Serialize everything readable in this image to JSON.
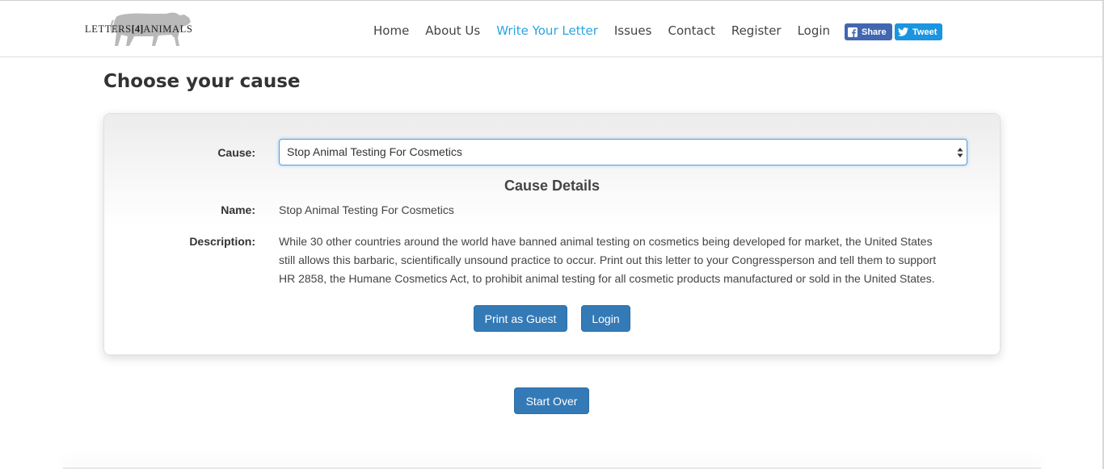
{
  "brand": {
    "logo_text_before": "LETTERS",
    "logo_text_mid": "[4]",
    "logo_text_after": "ANIMALS"
  },
  "nav": {
    "items": [
      {
        "label": "Home",
        "active": false
      },
      {
        "label": "About Us",
        "active": false
      },
      {
        "label": "Write Your Letter",
        "active": true
      },
      {
        "label": "Issues",
        "active": false
      },
      {
        "label": "Contact",
        "active": false
      },
      {
        "label": "Register",
        "active": false
      },
      {
        "label": "Login",
        "active": false
      }
    ],
    "active_color": "#2aa4df"
  },
  "social": {
    "facebook_label": "Share",
    "twitter_label": "Tweet",
    "facebook_color": "#4267b2",
    "twitter_color": "#1b95e0"
  },
  "page": {
    "title": "Choose your cause"
  },
  "form": {
    "cause_label": "Cause:",
    "cause_selected": "Stop Animal Testing For Cosmetics",
    "details_title": "Cause Details",
    "name_label": "Name:",
    "name_value": "Stop Animal Testing For Cosmetics",
    "description_label": "Description:",
    "description_value": "While 30 other countries around the world have banned animal testing on cosmetics being developed for market, the United States still allows this barbaric, scientifically unsound practice to occur. Print out this letter to your Congressperson and tell them to support HR 2858, the Humane Cosmetics Act, to prohibit animal testing for all cosmetic products manufactured or sold in the United States.",
    "print_guest_label": "Print as Guest",
    "login_label": "Login"
  },
  "footer": {
    "start_over_label": "Start Over"
  },
  "colors": {
    "primary_button": "#337ab7"
  }
}
